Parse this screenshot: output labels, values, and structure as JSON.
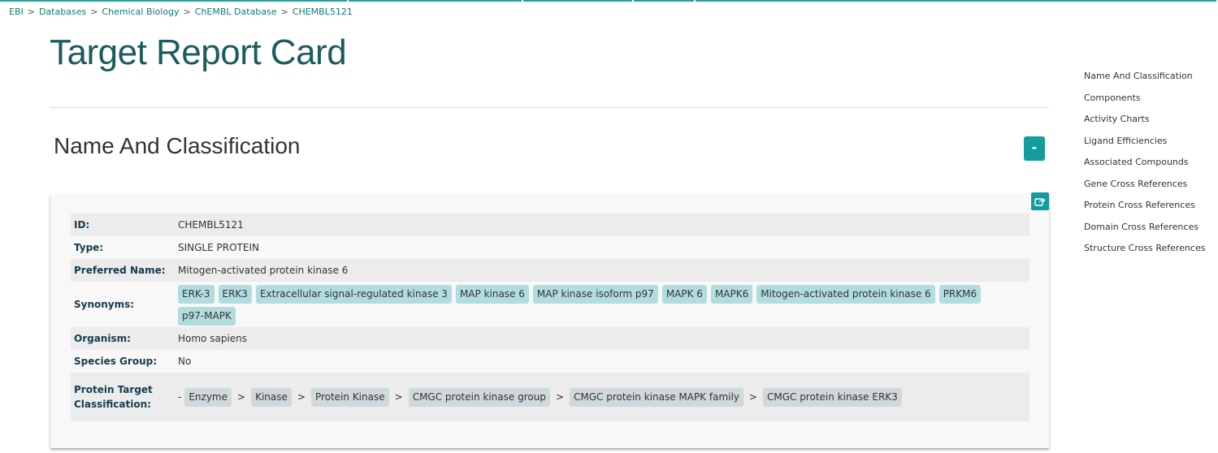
{
  "breadcrumb": [
    "EBI",
    "Databases",
    "Chemical Biology",
    "ChEMBL Database",
    "CHEMBL5121"
  ],
  "breadcrumb_separator": ">",
  "page_title": "Target Report Card",
  "section": {
    "title": "Name And Classification",
    "collapse_label": "-"
  },
  "properties": {
    "id": {
      "label": "ID:",
      "value": "CHEMBL5121"
    },
    "type": {
      "label": "Type:",
      "value": "SINGLE PROTEIN"
    },
    "preferred_name": {
      "label": "Preferred Name:",
      "value": "Mitogen-activated protein kinase 6"
    },
    "synonyms": {
      "label": "Synonyms:",
      "values": [
        "ERK-3",
        "ERK3",
        "Extracellular signal-regulated kinase 3",
        "MAP kinase 6",
        "MAP kinase isoform p97",
        "MAPK 6",
        "MAPK6",
        "Mitogen-activated protein kinase 6",
        "PRKM6",
        "p97-MAPK"
      ]
    },
    "organism": {
      "label": "Organism:",
      "value": "Homo sapiens"
    },
    "species_group": {
      "label": "Species Group:",
      "value": "No"
    },
    "classification": {
      "label_line1": "Protein Target",
      "label_line2": "Classification:",
      "prefix": "-",
      "path": [
        "Enzyme",
        "Kinase",
        "Protein Kinase",
        "CMGC protein kinase group",
        "CMGC protein kinase MAPK family",
        "CMGC protein kinase ERK3"
      ],
      "separator": ">"
    }
  },
  "toc": [
    "Name And Classification",
    "Components",
    "Activity Charts",
    "Ligand Efficiencies",
    "Associated Compounds",
    "Gene Cross References",
    "Protein Cross References",
    "Domain Cross References",
    "Structure Cross References"
  ],
  "colors": {
    "accent": "#139c9c",
    "title": "#1c5b5f",
    "link": "#0f7a7a",
    "synonym_tag": "#b2dde0",
    "classification_tag": "#cfd9db"
  },
  "icons": {
    "share": "share-icon"
  }
}
